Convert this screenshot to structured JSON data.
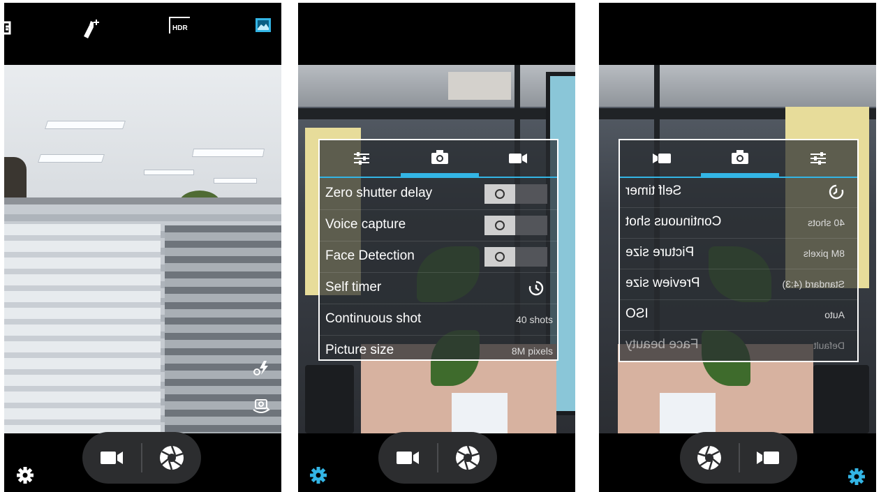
{
  "colors": {
    "accent": "#33b5e5",
    "panel_border": "#ffffff",
    "bar": "#000000",
    "pill": "#2c2d2f"
  },
  "screen1": {
    "top_icons": [
      "exposure-icon",
      "magic-wand-icon",
      "hdr-icon",
      "picture-mode-icon"
    ],
    "hdr_label": "HDR",
    "side_icons": [
      "flash-auto-icon",
      "switch-camera-icon"
    ],
    "bottom": {
      "settings_icon": "gear-icon",
      "video_icon": "video-camera-icon",
      "shutter_icon": "aperture-icon"
    }
  },
  "screen2": {
    "tabs": [
      {
        "icon": "sliders-icon",
        "active": false
      },
      {
        "icon": "camera-icon",
        "active": true
      },
      {
        "icon": "video-camera-icon",
        "active": false
      }
    ],
    "rows": [
      {
        "label": "Zero shutter delay",
        "type": "toggle",
        "value": ""
      },
      {
        "label": "Voice capture",
        "type": "toggle",
        "value": ""
      },
      {
        "label": "Face Detection",
        "type": "toggle",
        "value": ""
      },
      {
        "label": "Self timer",
        "type": "icon",
        "value": "timer-icon"
      },
      {
        "label": "Continuous shot",
        "type": "text",
        "value": "40 shots"
      },
      {
        "label": "Picture size",
        "type": "text",
        "value": "8M pixels"
      }
    ]
  },
  "screen3": {
    "tabs": [
      {
        "icon": "video-camera-icon",
        "active": false
      },
      {
        "icon": "camera-icon",
        "active": true
      },
      {
        "icon": "sliders-icon",
        "active": false
      }
    ],
    "rows": [
      {
        "label": "Self timer",
        "value": ""
      },
      {
        "label": "Continuous shot",
        "value": "40 shots"
      },
      {
        "label": "Picture size",
        "value": "8M pixels"
      },
      {
        "label": "Preview size",
        "value": "Standard (4:3)"
      },
      {
        "label": "ISO",
        "value": "Auto"
      },
      {
        "label": "Face beauty",
        "value": "Default"
      }
    ]
  }
}
